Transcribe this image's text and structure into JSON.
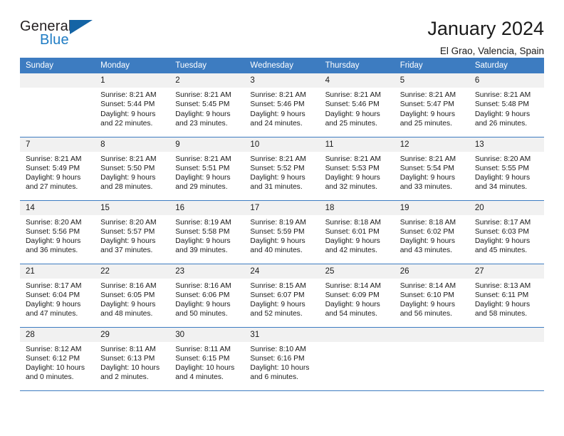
{
  "brand": {
    "name_part1": "General",
    "name_part2": "Blue",
    "triangle_color": "#1464a5",
    "blue_text_color": "#1f7cc4"
  },
  "header": {
    "title": "January 2024",
    "location": "El Grao, Valencia, Spain"
  },
  "theme": {
    "header_blue": "#3d7cc1",
    "daynum_band": "#f1f1f1",
    "text": "#1a1a1a"
  },
  "weekday_headers": [
    "Sunday",
    "Monday",
    "Tuesday",
    "Wednesday",
    "Thursday",
    "Friday",
    "Saturday"
  ],
  "weeks": [
    [
      {
        "day": "",
        "blank": true,
        "sunrise": "",
        "sunset": "",
        "daylight_line1": "",
        "daylight_line2": ""
      },
      {
        "day": "1",
        "sunrise": "Sunrise: 8:21 AM",
        "sunset": "Sunset: 5:44 PM",
        "daylight_line1": "Daylight: 9 hours",
        "daylight_line2": "and 22 minutes."
      },
      {
        "day": "2",
        "sunrise": "Sunrise: 8:21 AM",
        "sunset": "Sunset: 5:45 PM",
        "daylight_line1": "Daylight: 9 hours",
        "daylight_line2": "and 23 minutes."
      },
      {
        "day": "3",
        "sunrise": "Sunrise: 8:21 AM",
        "sunset": "Sunset: 5:46 PM",
        "daylight_line1": "Daylight: 9 hours",
        "daylight_line2": "and 24 minutes."
      },
      {
        "day": "4",
        "sunrise": "Sunrise: 8:21 AM",
        "sunset": "Sunset: 5:46 PM",
        "daylight_line1": "Daylight: 9 hours",
        "daylight_line2": "and 25 minutes."
      },
      {
        "day": "5",
        "sunrise": "Sunrise: 8:21 AM",
        "sunset": "Sunset: 5:47 PM",
        "daylight_line1": "Daylight: 9 hours",
        "daylight_line2": "and 25 minutes."
      },
      {
        "day": "6",
        "sunrise": "Sunrise: 8:21 AM",
        "sunset": "Sunset: 5:48 PM",
        "daylight_line1": "Daylight: 9 hours",
        "daylight_line2": "and 26 minutes."
      }
    ],
    [
      {
        "day": "7",
        "sunrise": "Sunrise: 8:21 AM",
        "sunset": "Sunset: 5:49 PM",
        "daylight_line1": "Daylight: 9 hours",
        "daylight_line2": "and 27 minutes."
      },
      {
        "day": "8",
        "sunrise": "Sunrise: 8:21 AM",
        "sunset": "Sunset: 5:50 PM",
        "daylight_line1": "Daylight: 9 hours",
        "daylight_line2": "and 28 minutes."
      },
      {
        "day": "9",
        "sunrise": "Sunrise: 8:21 AM",
        "sunset": "Sunset: 5:51 PM",
        "daylight_line1": "Daylight: 9 hours",
        "daylight_line2": "and 29 minutes."
      },
      {
        "day": "10",
        "sunrise": "Sunrise: 8:21 AM",
        "sunset": "Sunset: 5:52 PM",
        "daylight_line1": "Daylight: 9 hours",
        "daylight_line2": "and 31 minutes."
      },
      {
        "day": "11",
        "sunrise": "Sunrise: 8:21 AM",
        "sunset": "Sunset: 5:53 PM",
        "daylight_line1": "Daylight: 9 hours",
        "daylight_line2": "and 32 minutes."
      },
      {
        "day": "12",
        "sunrise": "Sunrise: 8:21 AM",
        "sunset": "Sunset: 5:54 PM",
        "daylight_line1": "Daylight: 9 hours",
        "daylight_line2": "and 33 minutes."
      },
      {
        "day": "13",
        "sunrise": "Sunrise: 8:20 AM",
        "sunset": "Sunset: 5:55 PM",
        "daylight_line1": "Daylight: 9 hours",
        "daylight_line2": "and 34 minutes."
      }
    ],
    [
      {
        "day": "14",
        "sunrise": "Sunrise: 8:20 AM",
        "sunset": "Sunset: 5:56 PM",
        "daylight_line1": "Daylight: 9 hours",
        "daylight_line2": "and 36 minutes."
      },
      {
        "day": "15",
        "sunrise": "Sunrise: 8:20 AM",
        "sunset": "Sunset: 5:57 PM",
        "daylight_line1": "Daylight: 9 hours",
        "daylight_line2": "and 37 minutes."
      },
      {
        "day": "16",
        "sunrise": "Sunrise: 8:19 AM",
        "sunset": "Sunset: 5:58 PM",
        "daylight_line1": "Daylight: 9 hours",
        "daylight_line2": "and 39 minutes."
      },
      {
        "day": "17",
        "sunrise": "Sunrise: 8:19 AM",
        "sunset": "Sunset: 5:59 PM",
        "daylight_line1": "Daylight: 9 hours",
        "daylight_line2": "and 40 minutes."
      },
      {
        "day": "18",
        "sunrise": "Sunrise: 8:18 AM",
        "sunset": "Sunset: 6:01 PM",
        "daylight_line1": "Daylight: 9 hours",
        "daylight_line2": "and 42 minutes."
      },
      {
        "day": "19",
        "sunrise": "Sunrise: 8:18 AM",
        "sunset": "Sunset: 6:02 PM",
        "daylight_line1": "Daylight: 9 hours",
        "daylight_line2": "and 43 minutes."
      },
      {
        "day": "20",
        "sunrise": "Sunrise: 8:17 AM",
        "sunset": "Sunset: 6:03 PM",
        "daylight_line1": "Daylight: 9 hours",
        "daylight_line2": "and 45 minutes."
      }
    ],
    [
      {
        "day": "21",
        "sunrise": "Sunrise: 8:17 AM",
        "sunset": "Sunset: 6:04 PM",
        "daylight_line1": "Daylight: 9 hours",
        "daylight_line2": "and 47 minutes."
      },
      {
        "day": "22",
        "sunrise": "Sunrise: 8:16 AM",
        "sunset": "Sunset: 6:05 PM",
        "daylight_line1": "Daylight: 9 hours",
        "daylight_line2": "and 48 minutes."
      },
      {
        "day": "23",
        "sunrise": "Sunrise: 8:16 AM",
        "sunset": "Sunset: 6:06 PM",
        "daylight_line1": "Daylight: 9 hours",
        "daylight_line2": "and 50 minutes."
      },
      {
        "day": "24",
        "sunrise": "Sunrise: 8:15 AM",
        "sunset": "Sunset: 6:07 PM",
        "daylight_line1": "Daylight: 9 hours",
        "daylight_line2": "and 52 minutes."
      },
      {
        "day": "25",
        "sunrise": "Sunrise: 8:14 AM",
        "sunset": "Sunset: 6:09 PM",
        "daylight_line1": "Daylight: 9 hours",
        "daylight_line2": "and 54 minutes."
      },
      {
        "day": "26",
        "sunrise": "Sunrise: 8:14 AM",
        "sunset": "Sunset: 6:10 PM",
        "daylight_line1": "Daylight: 9 hours",
        "daylight_line2": "and 56 minutes."
      },
      {
        "day": "27",
        "sunrise": "Sunrise: 8:13 AM",
        "sunset": "Sunset: 6:11 PM",
        "daylight_line1": "Daylight: 9 hours",
        "daylight_line2": "and 58 minutes."
      }
    ],
    [
      {
        "day": "28",
        "sunrise": "Sunrise: 8:12 AM",
        "sunset": "Sunset: 6:12 PM",
        "daylight_line1": "Daylight: 10 hours",
        "daylight_line2": "and 0 minutes."
      },
      {
        "day": "29",
        "sunrise": "Sunrise: 8:11 AM",
        "sunset": "Sunset: 6:13 PM",
        "daylight_line1": "Daylight: 10 hours",
        "daylight_line2": "and 2 minutes."
      },
      {
        "day": "30",
        "sunrise": "Sunrise: 8:11 AM",
        "sunset": "Sunset: 6:15 PM",
        "daylight_line1": "Daylight: 10 hours",
        "daylight_line2": "and 4 minutes."
      },
      {
        "day": "31",
        "sunrise": "Sunrise: 8:10 AM",
        "sunset": "Sunset: 6:16 PM",
        "daylight_line1": "Daylight: 10 hours",
        "daylight_line2": "and 6 minutes."
      },
      {
        "day": "",
        "blank": true,
        "sunrise": "",
        "sunset": "",
        "daylight_line1": "",
        "daylight_line2": ""
      },
      {
        "day": "",
        "blank": true,
        "sunrise": "",
        "sunset": "",
        "daylight_line1": "",
        "daylight_line2": ""
      },
      {
        "day": "",
        "blank": true,
        "sunrise": "",
        "sunset": "",
        "daylight_line1": "",
        "daylight_line2": ""
      }
    ]
  ]
}
